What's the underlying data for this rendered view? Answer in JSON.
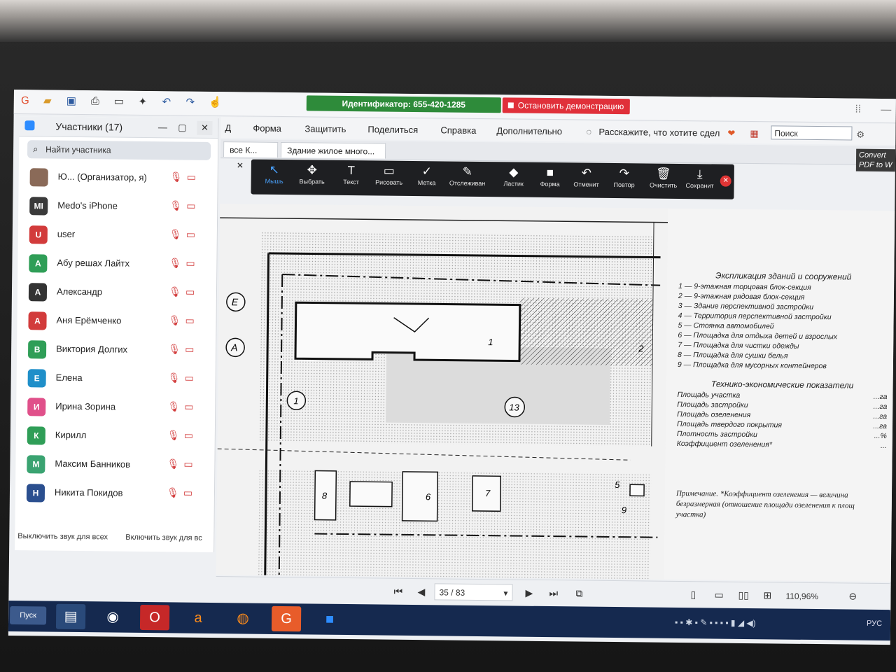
{
  "app": {
    "identifier_label": "Идентификатор: 655-420-1285",
    "stop_share_label": "Остановить демонстрацию"
  },
  "menu": {
    "items": [
      "Д",
      "Форма",
      "Защитить",
      "Поделиться",
      "Справка",
      "Дополнительно"
    ],
    "tell_me": "Расскажите, что хотите сдел",
    "search_placeholder": "Поиск",
    "convert_label": "Convert PDF to W"
  },
  "tabs": [
    {
      "label": "все К..."
    },
    {
      "label": "Здание жилое много..."
    }
  ],
  "annotation_toolbar": {
    "items": [
      {
        "label": "Мышь",
        "glyph": "↖",
        "active": true
      },
      {
        "label": "Выбрать",
        "glyph": "✥"
      },
      {
        "label": "Текст",
        "glyph": "T"
      },
      {
        "label": "Рисовать",
        "glyph": "▭"
      },
      {
        "label": "Метка",
        "glyph": "✓"
      },
      {
        "label": "Отслеживан",
        "glyph": "✎"
      },
      {
        "label": "Ластик",
        "glyph": "◆"
      },
      {
        "label": "Форма",
        "glyph": "■"
      },
      {
        "label": "Отменит",
        "glyph": "↶"
      },
      {
        "label": "Повтор",
        "glyph": "↷"
      },
      {
        "label": "Очистить",
        "glyph": "🗑"
      },
      {
        "label": "Сохранит",
        "glyph": "⤓"
      }
    ]
  },
  "participants": {
    "title": "Участники (17)",
    "search_placeholder": "Найти участника",
    "list": [
      {
        "initials": "",
        "name": "Ю...  (Организатор, я)",
        "color": "#8a6a58"
      },
      {
        "initials": "MI",
        "name": "Medo's iPhone",
        "color": "#3a3a3a"
      },
      {
        "initials": "U",
        "name": "user",
        "color": "#d23b3b"
      },
      {
        "initials": "А",
        "name": "Абу решах Лайтх",
        "color": "#2f9e57"
      },
      {
        "initials": "А",
        "name": "Александр",
        "color": "#333333"
      },
      {
        "initials": "А",
        "name": "Аня Ерёмченко",
        "color": "#d23b3b"
      },
      {
        "initials": "В",
        "name": "Виктория Долгих",
        "color": "#2f9e57"
      },
      {
        "initials": "Е",
        "name": "Елена",
        "color": "#1f8fc9"
      },
      {
        "initials": "И",
        "name": "Ирина Зорина",
        "color": "#e0508a"
      },
      {
        "initials": "К",
        "name": "Кирилл",
        "color": "#2f9e57"
      },
      {
        "initials": "М",
        "name": "Максим Банников",
        "color": "#3aa371"
      },
      {
        "initials": "Н",
        "name": "Никита Покидов",
        "color": "#2b4f8f"
      }
    ],
    "mute_all": "Выключить звук для всех",
    "unmute_all": "Включить звук для вс"
  },
  "document": {
    "legend_title": "Экспликация зданий и сооружений",
    "legend": [
      "1 — 9-этажная торцовая блок-секция",
      "2 — 9-этажная рядовая блок-секция",
      "3 — Здание перспективной застройки",
      "4 — Территория перспективной застройки",
      "5 — Стоянка автомобилей",
      "6 — Площадка для отдыха детей и взрослых",
      "7 — Площадка для чистки одежды",
      "8 — Площадка для сушки белья",
      "9 — Площадка для мусорных контейнеров"
    ],
    "tep_title": "Технико-экономические показатели",
    "tep": [
      {
        "name": "Площадь участка",
        "unit": "...га"
      },
      {
        "name": "Площадь застройки",
        "unit": "...га"
      },
      {
        "name": "Площадь озеленения",
        "unit": "...га"
      },
      {
        "name": "Площадь твердого покрытия",
        "unit": "...га"
      },
      {
        "name": "Плотность застройки",
        "unit": "...%"
      },
      {
        "name": "Коэффициент озеленения*",
        "unit": "..."
      }
    ],
    "note": "Примечание. *Коэффициент озеленения — величина безразмерная (отношение площади озеленения к площ участка)",
    "markers": [
      "E",
      "A",
      "1",
      "13",
      "2",
      "8",
      "6",
      "7",
      "5",
      "9",
      "1"
    ]
  },
  "navigation": {
    "page": "35 / 83",
    "zoom": "110,96%"
  },
  "taskbar": {
    "start": "Пуск",
    "lang": "РУС"
  }
}
